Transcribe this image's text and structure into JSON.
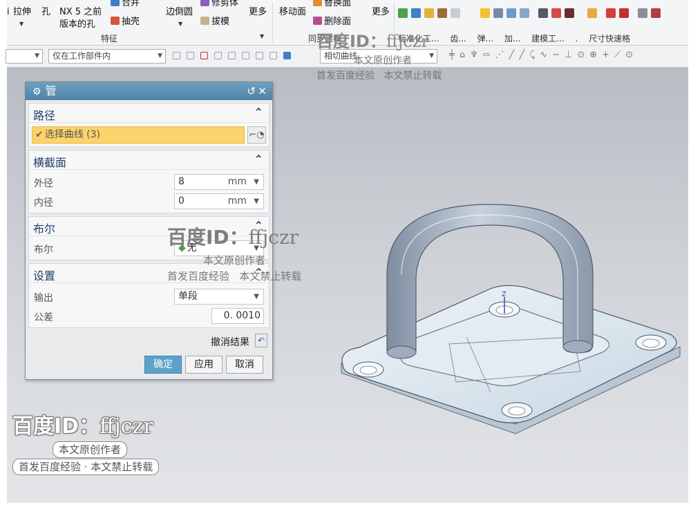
{
  "ribbon": {
    "extrude": "拉伸",
    "hole": "孔",
    "nx5_hole_line1": "NX 5 之前",
    "nx5_hole_line2": "版本的孔",
    "combine_partial": "合并",
    "shell": "抽壳",
    "edge_blend": "边倒圆",
    "trim_body_partial": "修剪体",
    "draft": "拔模",
    "more_1": "更多",
    "move_face": "移动面",
    "replace_face_partial": "替换面",
    "delete_face": "删除面",
    "more_2": "更多",
    "group_feature": "特征",
    "group_sync": "同步建模",
    "drop_standard": "标准化工...",
    "drop_gear": "齿...",
    "drop_spring": "弹...",
    "drop_add": "加...",
    "drop_modeling": "建模工...",
    "drop_dot": ".",
    "group_dim": "尺寸快速格"
  },
  "selection_bar": {
    "scope_filter": "仅在工作部件内",
    "curve_rule": "相切曲线"
  },
  "dialog": {
    "title": "管",
    "section_path": "路径",
    "select_curve": "选择曲线 (3)",
    "section_cross": "横截面",
    "outer_diameter_label": "外径",
    "outer_diameter_value": "8",
    "outer_unit": "mm",
    "inner_diameter_label": "内径",
    "inner_diameter_value": "0",
    "inner_unit": "mm",
    "section_boolean": "布尔",
    "boolean_label": "布尔",
    "boolean_value": "无",
    "section_settings": "设置",
    "output_label": "输出",
    "output_value": "单段",
    "tolerance_label": "公差",
    "tolerance_value": "0. 0010",
    "undo_result": "撤消结果",
    "ok": "确定",
    "apply": "应用",
    "cancel": "取消"
  },
  "viewport": {
    "axis_z": "Z"
  },
  "watermark": {
    "id_prefix": "百度ID：",
    "id_user": "ffjczr",
    "line1": "本文原创作者",
    "line2a": "首发百度经验",
    "line2b": "本文禁止转载",
    "line2_full": "首发百度经验 · 本文禁止转载"
  },
  "colors": {
    "dialog_title": "#5b8db0",
    "selection_highlight": "#fcd36a",
    "ok_button": "#5ca2c8",
    "part_body": "#dbe6ee",
    "pipe": "#a9b6c6"
  }
}
